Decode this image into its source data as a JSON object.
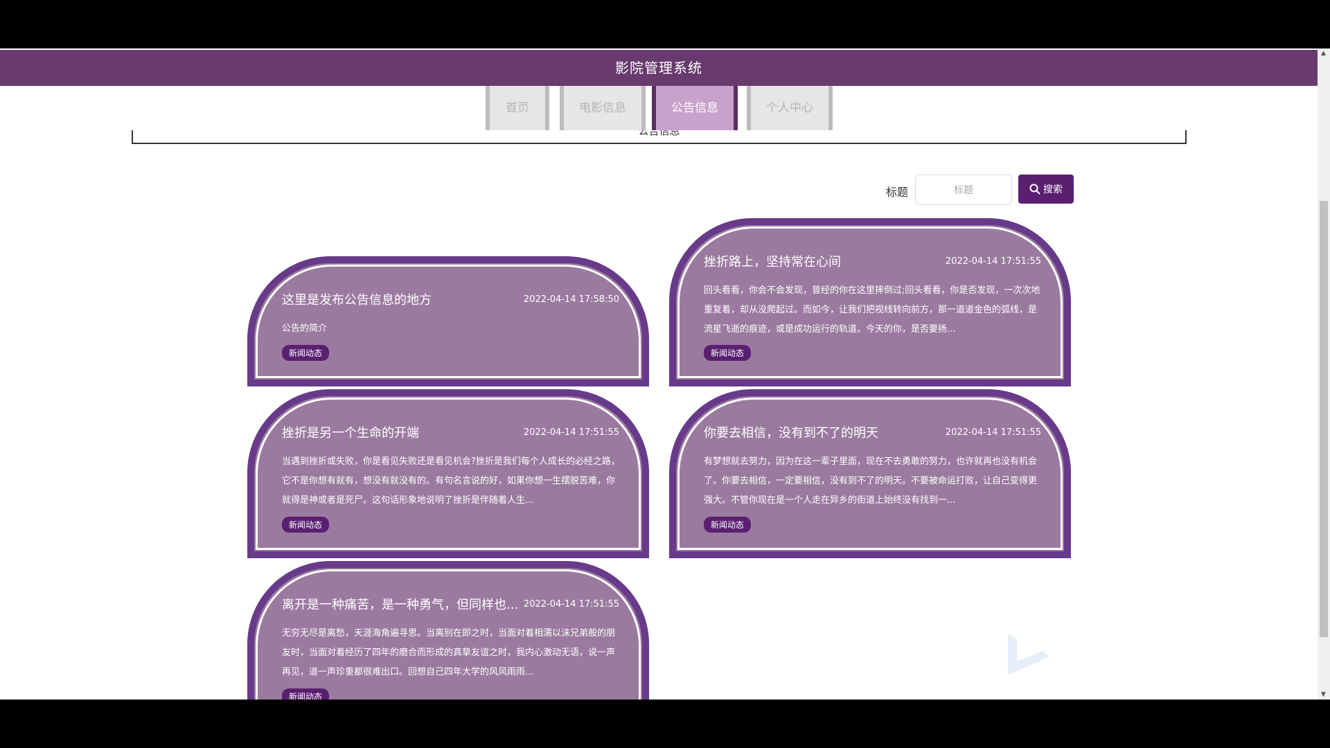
{
  "app": {
    "title": "影院管理系统"
  },
  "nav": {
    "tabs": [
      {
        "label": "首页"
      },
      {
        "label": "电影信息"
      },
      {
        "label": "公告信息",
        "active": true
      },
      {
        "label": "个人中心"
      }
    ]
  },
  "section": {
    "title": "公告信息"
  },
  "search": {
    "label": "标题",
    "placeholder": "标题",
    "button_label": "搜索"
  },
  "cards": [
    {
      "title": "这里是发布公告信息的地方",
      "time": "2022-04-14 17:58:50",
      "summary": "公告的简介",
      "tag": "新闻动态"
    },
    {
      "title": "挫折路上，坚持常在心间",
      "time": "2022-04-14 17:51:55",
      "summary": "回头看看，你会不会发现，曾经的你在这里摔倒过;回头看看，你是否发现，一次次地重复着，却从没爬起过。而如今，让我们把视线转向前方，那一道道金色的弧线，是流星飞逝的痕迹，或是成功运行的轨道。今天的你，是否要扬...",
      "tag": "新闻动态"
    },
    {
      "title": "挫折是另一个生命的开端",
      "time": "2022-04-14 17:51:55",
      "summary": "当遇到挫折或失败，你是看见失败还是看见机会?挫折是我们每个人成长的必经之路，它不是你想有就有，想没有就没有的。有句名言说的好，如果你想一生摆脱苦难，你就得是神或者是死尸。这句话形象地说明了挫折是伴随着人生...",
      "tag": "新闻动态"
    },
    {
      "title": "你要去相信，没有到不了的明天",
      "time": "2022-04-14 17:51:55",
      "summary": "有梦想就去努力，因为在这一辈子里面，现在不去勇敢的努力，也许就再也没有机会了。你要去相信，一定要相信，没有到不了的明天。不要被命运打败，让自己变得更强大。不管你现在是一个人走在异乡的街道上始终没有找到一...",
      "tag": "新闻动态"
    },
    {
      "title": "离开是一种痛苦，是一种勇气，但同样也...",
      "time": "2022-04-14 17:51:55",
      "summary": "无穷无尽是离愁，天涯海角遍寻思。当离别在即之时，当面对着相濡以沫兄弟般的朋友时，当面对着经历了四年的磨合而形成的真挚友谊之时，我内心激动无语，说一声再见，道一声珍重都很难出口。回想自己四年大学的风风雨雨...",
      "tag": "新闻动态"
    }
  ],
  "colors": {
    "header": "#683a6e",
    "accent": "#5a1f70",
    "card_bg": "#9b7aa0",
    "card_border": "#683a8a"
  }
}
